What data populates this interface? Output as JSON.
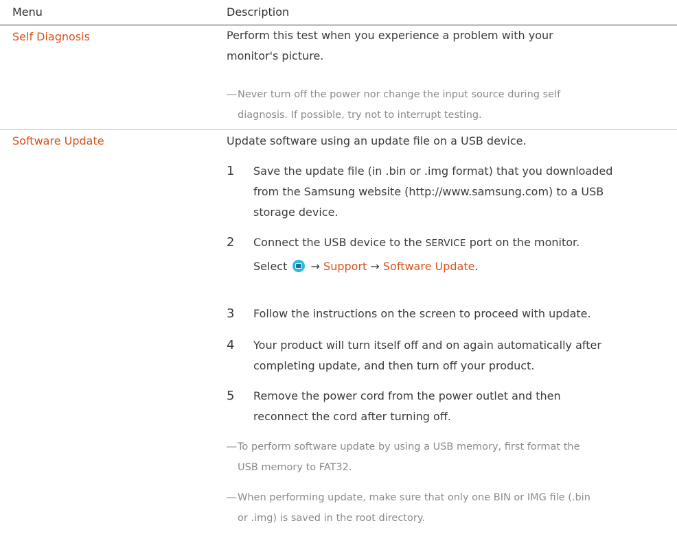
{
  "header": {
    "menu": "Menu",
    "description": "Description"
  },
  "self_diagnosis": {
    "label": "Self Diagnosis",
    "desc_line1": "Perform this test when you experience a problem with your",
    "desc_line2": "monitor's picture.",
    "note_dash": "―",
    "note_line1": "Never turn off the power nor change the input source during self",
    "note_line2": "diagnosis. If possible, try not to interrupt testing."
  },
  "software_update": {
    "label": "Software Update",
    "intro": "Update software using an update file on a USB device.",
    "steps": [
      {
        "num": "1",
        "line1": "Save the update file (in .bin or .img format) that you downloaded",
        "line2": "from the Samsung website (http://www.samsung.com) to a USB",
        "line3": "storage device."
      },
      {
        "num": "2",
        "line1_a": "Connect the USB device to the ",
        "service": "SERVICE",
        "line1_b": " port on the monitor.",
        "select_word": "Select",
        "arrow1": "→",
        "support": "Support",
        "arrow2": "→",
        "software_update": "Software Update",
        "period": "."
      },
      {
        "num": "3",
        "line1": "Follow the instructions on the screen to proceed with update."
      },
      {
        "num": "4",
        "line1": "Your product will turn itself off and on again automatically after",
        "line2": "completing update, and then turn off your product."
      },
      {
        "num": "5",
        "line1": "Remove the power cord from the power outlet and then",
        "line2": "reconnect the cord after turning off."
      }
    ],
    "notes": [
      {
        "dash": "―",
        "line1": "To perform software update by using a USB memory, first format the",
        "line2": "USB memory to FAT32."
      },
      {
        "dash": "―",
        "line1": "When performing update, make sure that only one BIN or IMG file (.bin",
        "line2": "or .img) is saved in the root directory."
      }
    ]
  },
  "colors": {
    "accent": "#d9521c",
    "text": "#3b3b3b",
    "note": "#8a8a8a",
    "icon": "#2bbbd8"
  },
  "icons": {
    "menu_button": "menu-button-icon"
  }
}
